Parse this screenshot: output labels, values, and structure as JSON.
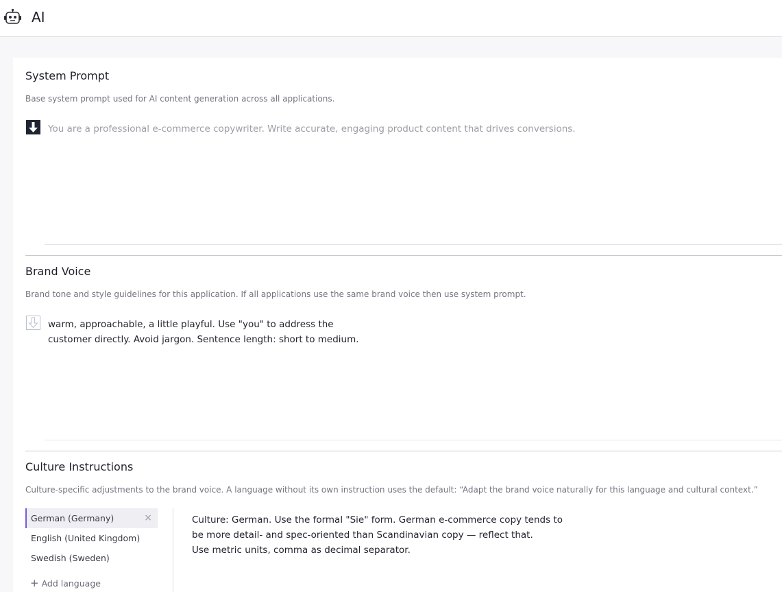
{
  "header": {
    "title": "AI",
    "icon": "robot-icon"
  },
  "system_prompt": {
    "title": "System Prompt",
    "description": "Base system prompt used for AI content generation across all applications.",
    "placeholder": "You are a professional e-commerce copywriter. Write accurate, engaging product content that drives conversions.",
    "icon": "download-arrow-icon"
  },
  "brand_voice": {
    "title": "Brand Voice",
    "description": "Brand tone and style guidelines for this application. If all applications use the same brand voice then use system prompt.",
    "value": "warm, approachable, a little playful. Use \"you\" to address the\ncustomer directly. Avoid jargon. Sentence length: short to medium.",
    "icon": "download-arrow-outline-icon"
  },
  "culture": {
    "title": "Culture Instructions",
    "description": "Culture-specific adjustments to the brand voice. A language without its own instruction uses the default: “Adapt the brand voice naturally for this language and cultural context.”",
    "languages": [
      {
        "label": "German (Germany)",
        "active": true
      },
      {
        "label": "English (United Kingdom)",
        "active": false
      },
      {
        "label": "Swedish (Sweden)",
        "active": false
      }
    ],
    "remove_symbol": "×",
    "add_language": "Add language",
    "add_symbol": "+",
    "value": "Culture: German. Use the formal \"Sie\" form. German e-commerce copy tends to\nbe more detail- and spec-oriented than Scandinavian copy — reflect that.\nUse metric units, comma as decimal separator."
  },
  "colors": {
    "accent": "#7a5bd1",
    "icon_dark": "#1f2433",
    "icon_light": "#b9c2d0"
  }
}
